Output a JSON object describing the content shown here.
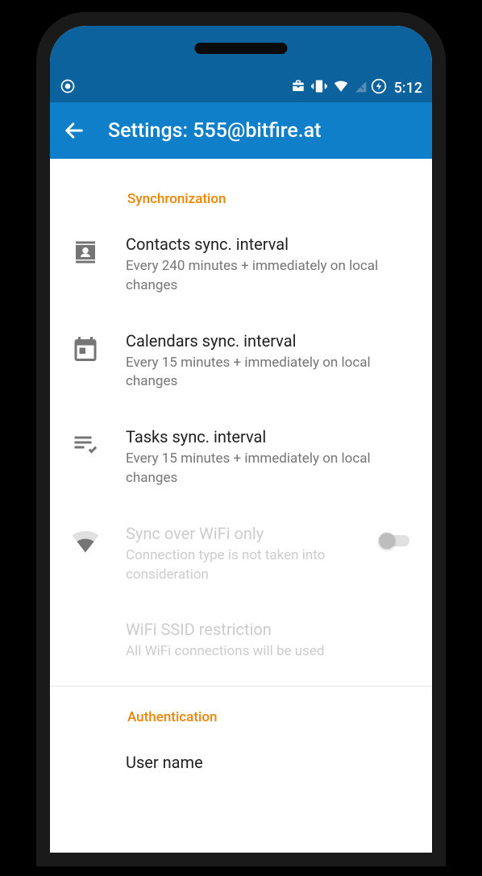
{
  "status_bar": {
    "time": "5:12"
  },
  "app_bar": {
    "title": "Settings: 555@bitfire.at"
  },
  "sections": {
    "sync": {
      "header": "Synchronization",
      "contacts": {
        "title": "Contacts sync. interval",
        "subtitle": "Every 240 minutes + immediately on local changes"
      },
      "calendars": {
        "title": "Calendars sync. interval",
        "subtitle": "Every 15 minutes + immediately on local changes"
      },
      "tasks": {
        "title": "Tasks sync. interval",
        "subtitle": "Every 15 minutes + immediately on local changes"
      },
      "wifi_only": {
        "title": "Sync over WiFi only",
        "subtitle": "Connection type is not taken into consideration"
      },
      "wifi_ssid": {
        "title": "WiFi SSID restriction",
        "subtitle": "All WiFi connections will be used"
      }
    },
    "auth": {
      "header": "Authentication",
      "username": {
        "title": "User name"
      }
    }
  }
}
